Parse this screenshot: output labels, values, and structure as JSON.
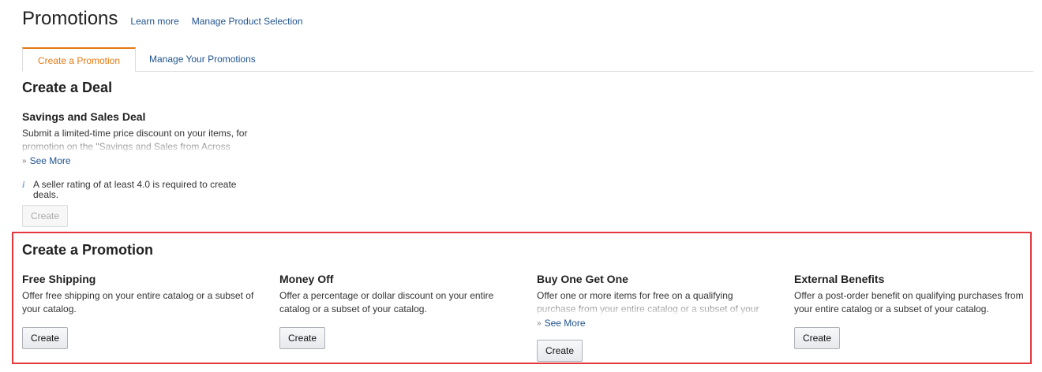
{
  "header": {
    "title": "Promotions",
    "links": [
      "Learn more",
      "Manage Product Selection"
    ]
  },
  "tabs": {
    "active": "Create a Promotion",
    "inactive": "Manage Your Promotions"
  },
  "deal_section": {
    "title": "Create a Deal",
    "card": {
      "title": "Savings and Sales Deal",
      "description": "Submit a limited-time price discount on your items, for promotion on the \"Savings and Sales from Across",
      "see_more": "See More",
      "note": "A seller rating of at least 4.0 is required to create deals.",
      "button": "Create"
    }
  },
  "promo_section": {
    "title": "Create a Promotion",
    "cards": [
      {
        "title": "Free Shipping",
        "description": "Offer free shipping on your entire catalog or a subset of your catalog.",
        "button": "Create"
      },
      {
        "title": "Money Off",
        "description": "Offer a percentage or dollar discount on your entire catalog or a subset of your catalog.",
        "button": "Create"
      },
      {
        "title": "Buy One Get One",
        "description": "Offer one or more items for free on a qualifying purchase from your entire catalog or a subset of your",
        "see_more": "See More",
        "button": "Create"
      },
      {
        "title": "External Benefits",
        "description": "Offer a post-order benefit on qualifying purchases from your entire catalog or a subset of your catalog.",
        "button": "Create"
      }
    ]
  },
  "colors": {
    "link": "#21548e",
    "active_tab": "#e47911",
    "highlight": "#e4373d"
  }
}
